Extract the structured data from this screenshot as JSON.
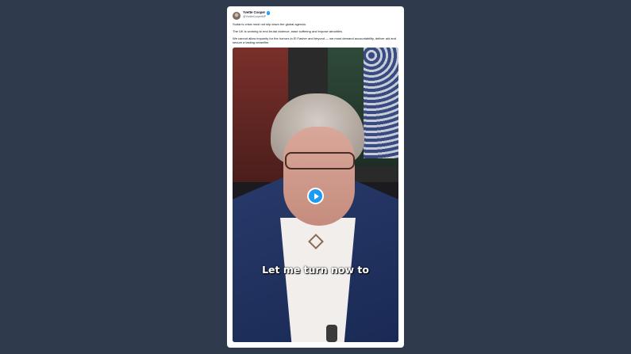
{
  "tweet": {
    "author_name": "Yvette Cooper",
    "author_handle": "@YvetteCooperMP",
    "paragraphs": [
      "Sudan's crisis must not slip down the global agenda.",
      "The UK is working to end brutal violence, ease suffering and expose atrocities.",
      "We cannot allow impunity for the horrors in El Fasher and beyond — we must demand accountability, deliver aid and secure a lasting ceasefire."
    ]
  },
  "video": {
    "caption": "Let me turn now to",
    "play_icon": "play-icon"
  },
  "colors": {
    "background": "#2f3a4c",
    "card": "#ffffff",
    "accent": "#1d9bf0"
  }
}
